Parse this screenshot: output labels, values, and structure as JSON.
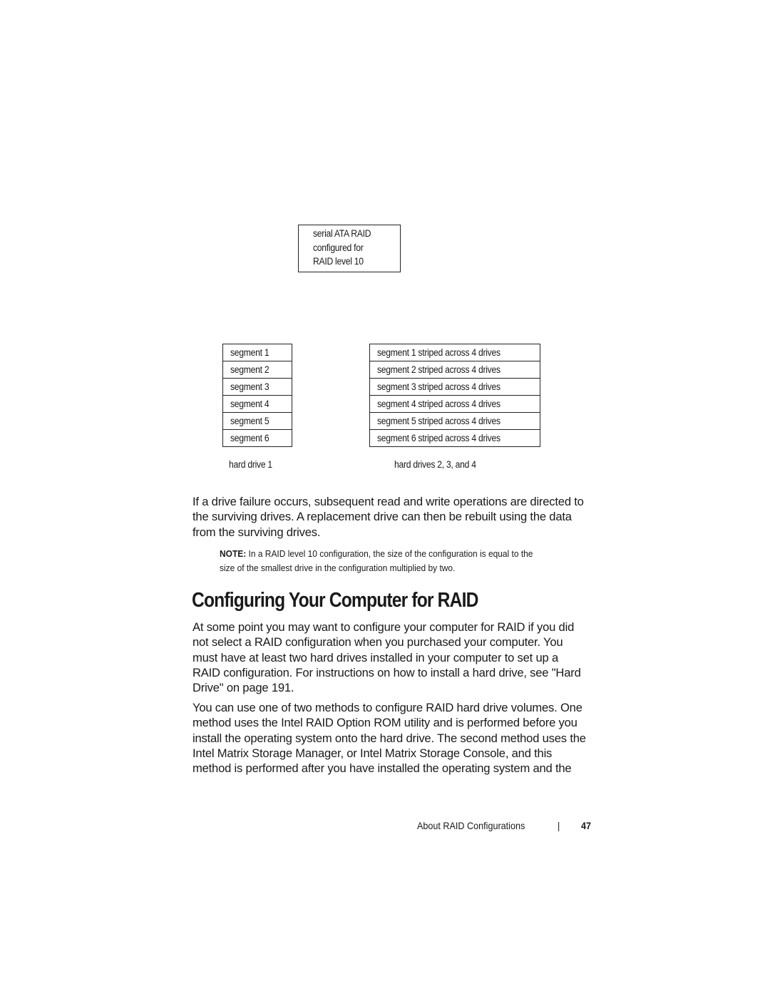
{
  "diagram": {
    "top_box_lines": [
      "serial ATA RAID",
      "configured for",
      "RAID level 10"
    ],
    "hard_drive_1": {
      "segments": [
        "segment 1",
        "segment 2",
        "segment 3",
        "segment 4",
        "segment 5",
        "segment 6"
      ],
      "label": "hard drive 1"
    },
    "hard_drives_234": {
      "segments": [
        "segment 1 striped across 4 drives",
        "segment 2 striped across 4 drives",
        "segment 3 striped across 4 drives",
        "segment 4 striped across 4 drives",
        "segment 5 striped across 4 drives",
        "segment 6 striped across 4 drives"
      ],
      "label": "hard drives 2, 3, and 4"
    }
  },
  "paragraph_failure": [
    "If a drive failure occurs, subsequent read and write operations are directed to",
    "the surviving drives. A replacement drive can then be rebuilt using the data",
    "from the surviving drives."
  ],
  "note": {
    "label": "NOTE:",
    "lines": [
      " In a RAID level 10 configuration, the size of the configuration is equal to the",
      "size of the smallest drive in the configuration multiplied by two."
    ]
  },
  "section_heading": "Configuring Your Computer for RAID",
  "paragraph_configure": [
    "At some point you may want to configure your computer for RAID if you did",
    "not select a RAID configuration when you purchased your computer. You",
    "must have at least two hard drives installed in your computer to set up a",
    "RAID configuration. For instructions on how to install a hard drive, see \"Hard",
    "Drive\" on page 191."
  ],
  "paragraph_methods": [
    "You can use one of two methods to configure RAID hard drive volumes. One",
    "method uses the Intel RAID Option ROM utility and is performed before you",
    "install the operating system onto the hard drive. The second method uses the",
    "Intel Matrix Storage Manager, or Intel Matrix Storage Console, and this",
    "method is performed after you have installed the operating system and the"
  ],
  "footer": {
    "section_title": "About RAID Configurations",
    "separator": "|",
    "page_number": "47"
  }
}
